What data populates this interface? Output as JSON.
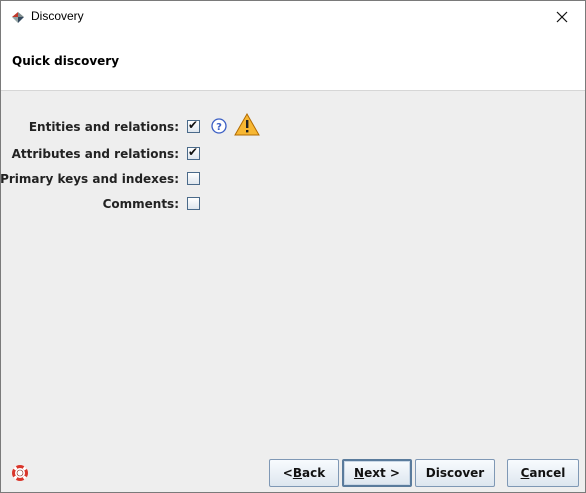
{
  "window": {
    "title": "Discovery",
    "close_glyph": "✕"
  },
  "header": {
    "title": "Quick discovery"
  },
  "options": [
    {
      "label": "Entities and relations:",
      "checked": true
    },
    {
      "label": "Attributes and relations:",
      "checked": true
    },
    {
      "label": "Primary keys and indexes:",
      "checked": false
    },
    {
      "label": "Comments:",
      "checked": false
    }
  ],
  "icons": {
    "help": "help-icon",
    "warning": "warning-icon",
    "lifebuoy": "lifebuoy-icon",
    "help_color": "#3b5fc4",
    "warning_color": "#f2a93b",
    "lifebuoy_color": "#d9362b"
  },
  "buttons": {
    "back_lt": "< ",
    "back_mnemonic": "B",
    "back_rest": "ack",
    "next_mnemonic": "N",
    "next_rest": "ext >",
    "discover": "Discover",
    "cancel_mnemonic": "C",
    "cancel_rest": "ancel"
  }
}
